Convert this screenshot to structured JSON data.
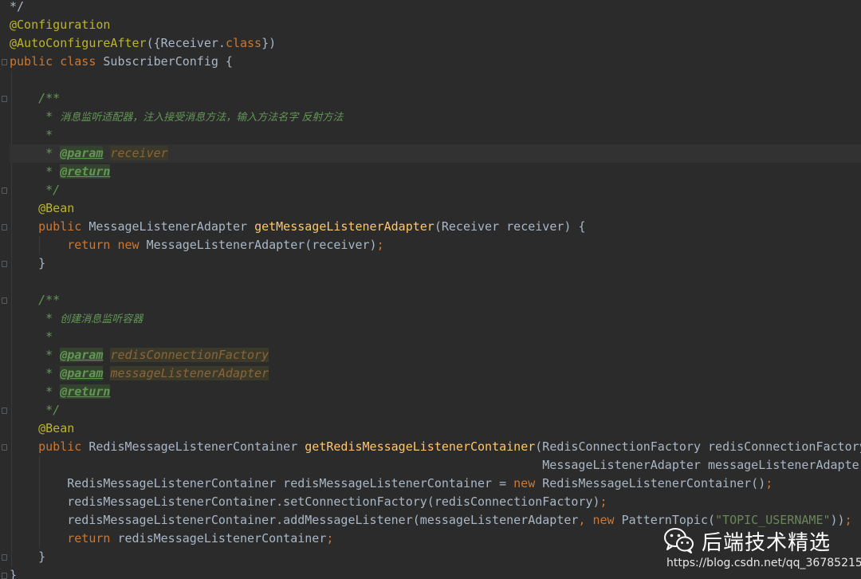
{
  "lines": [
    [
      [
        "plain",
        "*/"
      ]
    ],
    [
      [
        "annot",
        "@Configuration"
      ]
    ],
    [
      [
        "annot",
        "@AutoConfigureAfter"
      ],
      [
        "plain",
        "({Receiver."
      ],
      [
        "kw",
        "class"
      ],
      [
        "plain",
        "})"
      ]
    ],
    [
      [
        "kw",
        "public class "
      ],
      [
        "plain",
        "SubscriberConfig {"
      ]
    ],
    [],
    [
      [
        "doc",
        "    /**"
      ]
    ],
    [
      [
        "doc",
        "     * "
      ],
      [
        "doc cn",
        "消息监听适配器，注入接受消息方法，输入方法名字 反射方法"
      ]
    ],
    [
      [
        "doc",
        "     *"
      ]
    ],
    [
      [
        "doc",
        "     * "
      ],
      [
        "doctag",
        "@param"
      ],
      [
        "doc",
        " "
      ],
      [
        "docparam",
        "receiver"
      ]
    ],
    [
      [
        "doc",
        "     * "
      ],
      [
        "doctag",
        "@return"
      ]
    ],
    [
      [
        "doc",
        "     */"
      ]
    ],
    [
      [
        "annot",
        "    @Bean"
      ]
    ],
    [
      [
        "kw",
        "    public "
      ],
      [
        "plain",
        "MessageListenerAdapter "
      ],
      [
        "fn",
        "getMessageListenerAdapter"
      ],
      [
        "plain",
        "(Receiver receiver) {"
      ]
    ],
    [
      [
        "kw",
        "        return new "
      ],
      [
        "plain",
        "MessageListenerAdapter(receiver)"
      ],
      [
        "kw",
        ";"
      ]
    ],
    [
      [
        "plain",
        "    }"
      ]
    ],
    [],
    [
      [
        "doc",
        "    /**"
      ]
    ],
    [
      [
        "doc",
        "     * "
      ],
      [
        "doc cn",
        "创建消息监听容器"
      ]
    ],
    [
      [
        "doc",
        "     *"
      ]
    ],
    [
      [
        "doc",
        "     * "
      ],
      [
        "doctag",
        "@param"
      ],
      [
        "doc",
        " "
      ],
      [
        "docparam",
        "redisConnectionFactory"
      ]
    ],
    [
      [
        "doc",
        "     * "
      ],
      [
        "doctag",
        "@param"
      ],
      [
        "doc",
        " "
      ],
      [
        "docparam",
        "messageListenerAdapter"
      ]
    ],
    [
      [
        "doc",
        "     * "
      ],
      [
        "doctag",
        "@return"
      ]
    ],
    [
      [
        "doc",
        "     */"
      ]
    ],
    [
      [
        "annot",
        "    @Bean"
      ]
    ],
    [
      [
        "kw",
        "    public "
      ],
      [
        "plain",
        "RedisMessageListenerContainer "
      ],
      [
        "fn",
        "getRedisMessageListenerContainer"
      ],
      [
        "plain",
        "(RedisConnectionFactory redisConnectionFactory"
      ],
      [
        "kw",
        ","
      ]
    ],
    [
      [
        "plain",
        "                                                                          MessageListenerAdapter messageListenerAdapter) {"
      ]
    ],
    [
      [
        "plain",
        "        RedisMessageListenerContainer redisMessageListenerContainer = "
      ],
      [
        "kw",
        "new "
      ],
      [
        "plain",
        "RedisMessageListenerContainer()"
      ],
      [
        "kw",
        ";"
      ]
    ],
    [
      [
        "plain",
        "        redisMessageListenerContainer.setConnectionFactory(redisConnectionFactory)"
      ],
      [
        "kw",
        ";"
      ]
    ],
    [
      [
        "plain",
        "        redisMessageListenerContainer.addMessageListener(messageListenerAdapter"
      ],
      [
        "kw",
        ", new "
      ],
      [
        "plain",
        "PatternTopic("
      ],
      [
        "str",
        "\"TOPIC_USERNAME\""
      ],
      [
        "plain",
        "))"
      ],
      [
        "kw",
        ";"
      ]
    ],
    [
      [
        "kw",
        "        return "
      ],
      [
        "plain",
        "redisMessageListenerContainer"
      ],
      [
        "kw",
        ";"
      ]
    ],
    [
      [
        "plain",
        "    }"
      ]
    ],
    [
      [
        "plain",
        "}"
      ]
    ]
  ],
  "current_line": 8,
  "watermark": {
    "icon": "wechat-icon",
    "title": "后端技术精选",
    "url": "https://blog.csdn.net/qq_36785215"
  }
}
